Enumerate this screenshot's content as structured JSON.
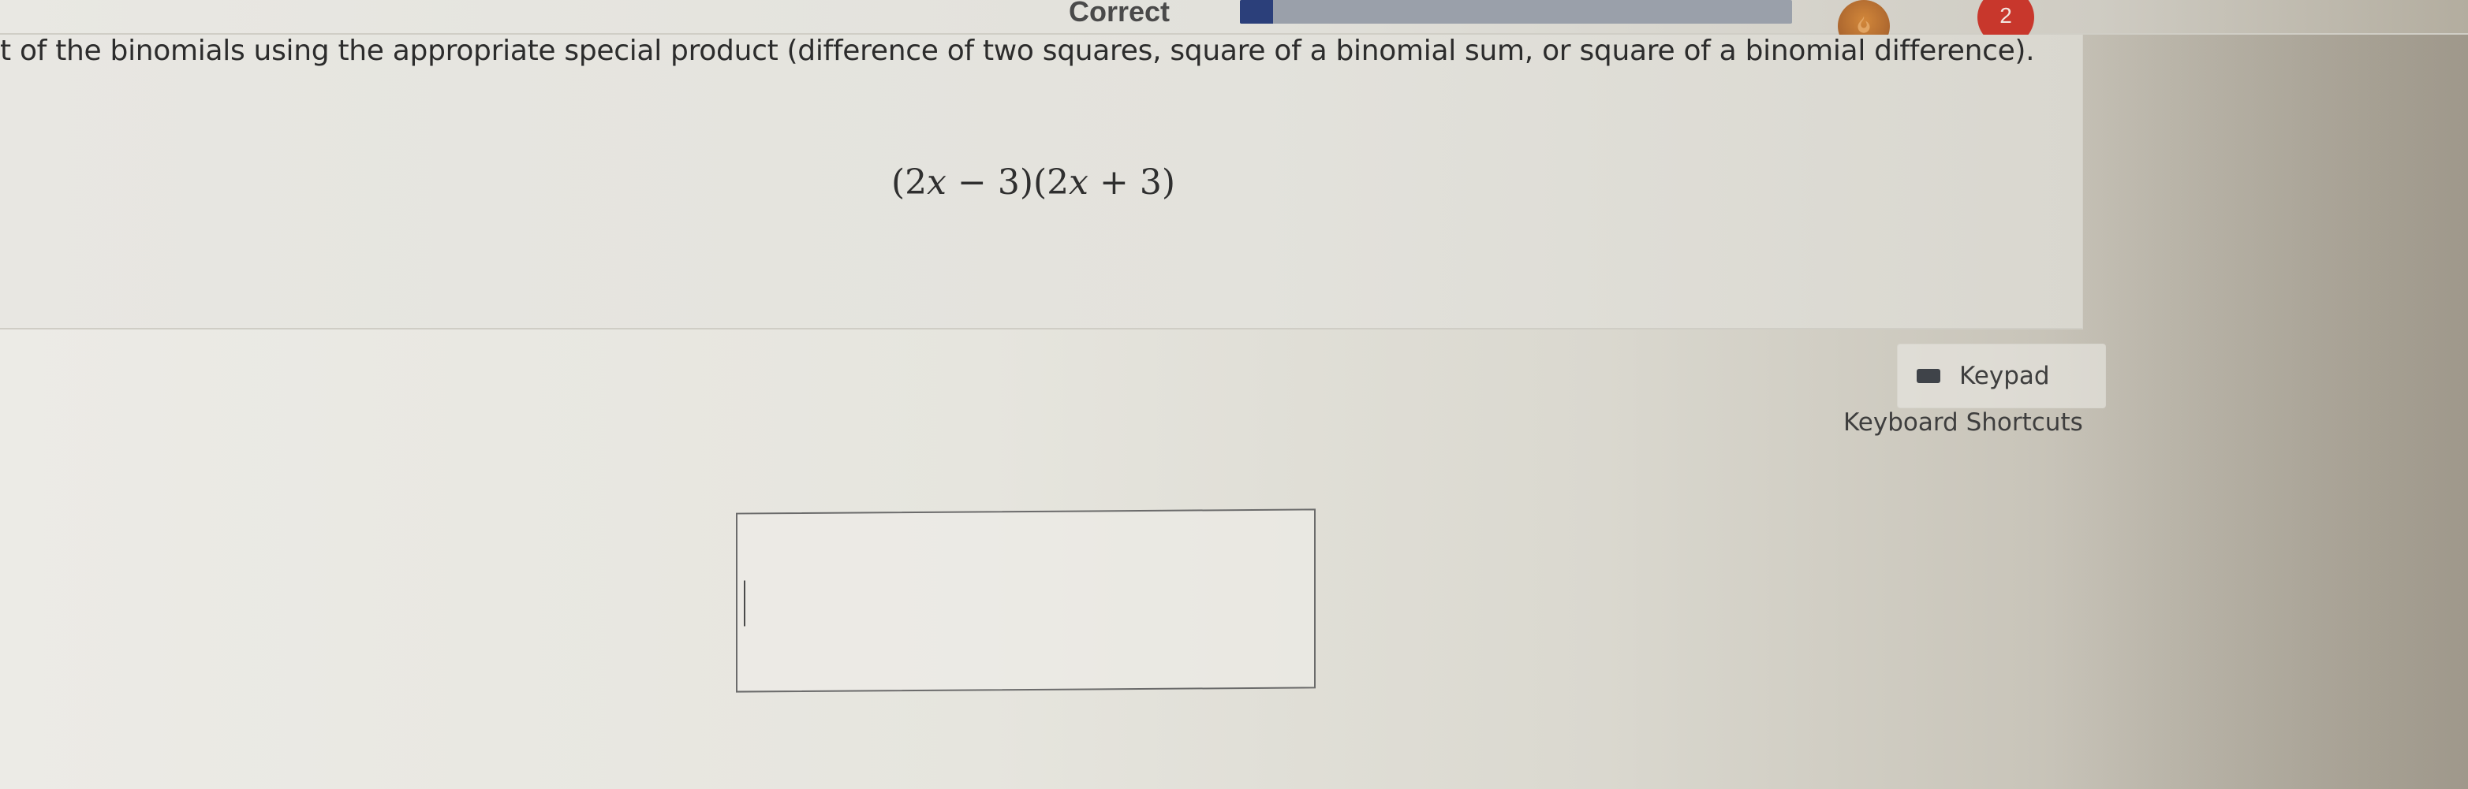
{
  "header": {
    "status_label": "Correct",
    "progress_fraction": 0.06,
    "streak_icon": "flame-icon",
    "badge_count": "2"
  },
  "question": {
    "instruction": "t of the binomials using the appropriate special product (difference of two squares, square of a binomial sum, or square of a binomial difference).",
    "expression": {
      "coef1": "(2",
      "var1": "x",
      "op1": " − 3)(2",
      "var2": "x",
      "op2": " + 3)"
    }
  },
  "tools": {
    "keypad_label": "Keypad",
    "keypad_icon": "keyboard-icon",
    "shortcuts_label": "Keyboard Shortcuts"
  },
  "answer": {
    "value": ""
  },
  "colors": {
    "progress_fill": "#2b3f7a",
    "badge": "#c8372c",
    "streak": "#b06a30"
  }
}
